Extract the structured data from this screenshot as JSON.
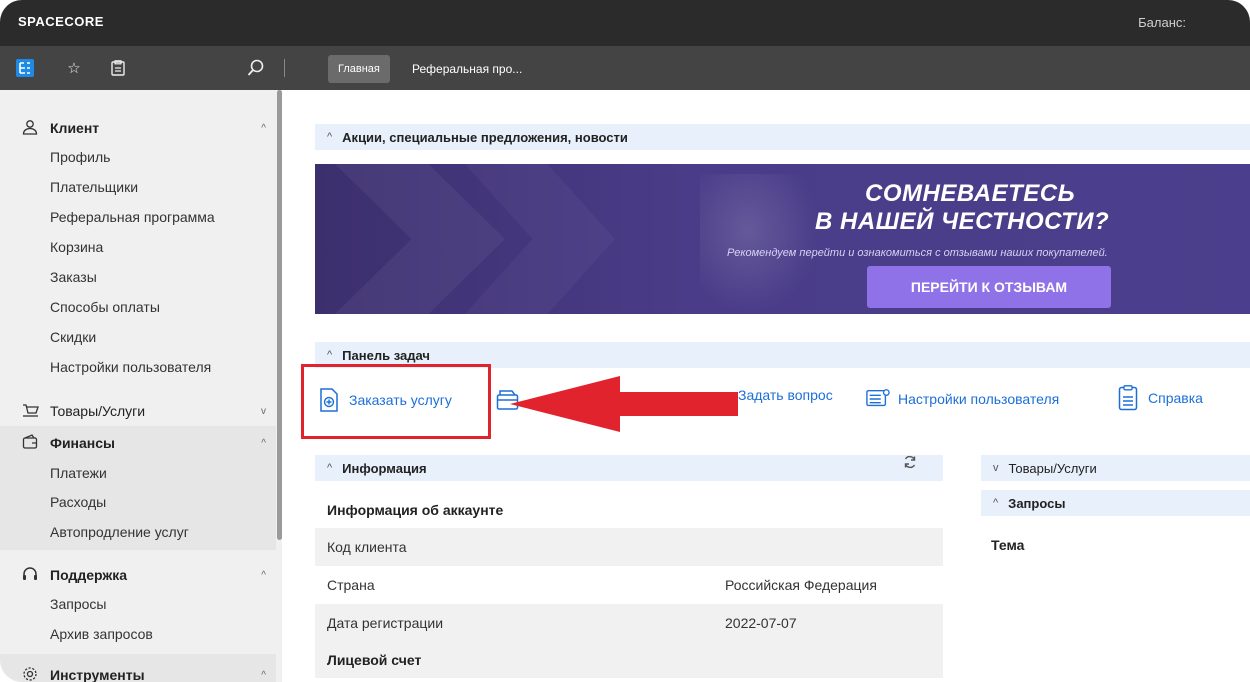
{
  "app": {
    "logo": "SPACECORE",
    "balance_label": "Баланс:"
  },
  "toolbar": {
    "icons": [
      "tree-icon",
      "star-icon",
      "clipboard-icon",
      "search-icon"
    ],
    "tabs": [
      {
        "label": "Главная",
        "active": true
      },
      {
        "label": "Реферальная про...",
        "active": false
      }
    ]
  },
  "sidebar": {
    "groups": [
      {
        "label": "Клиент",
        "icon": "client-icon",
        "expanded": true,
        "items": [
          "Профиль",
          "Плательщики",
          "Реферальная программа",
          "Корзина",
          "Заказы",
          "Способы оплаты",
          "Скидки",
          "Настройки пользователя"
        ]
      },
      {
        "label": "Товары/Услуги",
        "icon": "cart-icon",
        "expanded": false,
        "items": []
      },
      {
        "label": "Финансы",
        "icon": "wallet-icon",
        "expanded": true,
        "items": [
          "Платежи",
          "Расходы",
          "Автопродление услуг"
        ]
      },
      {
        "label": "Поддержка",
        "icon": "headset-icon",
        "expanded": true,
        "items": [
          "Запросы",
          "Архив запросов"
        ]
      },
      {
        "label": "Инструменты",
        "icon": "gear-icon",
        "expanded": true,
        "items": []
      }
    ]
  },
  "main": {
    "news_section": "Акции, специальные предложения, новости",
    "banner": {
      "title_line1": "СОМНЕВАЕТЕСЬ",
      "title_line2": "В НАШЕЙ ЧЕСТНОСТИ?",
      "subtitle": "Рекомендуем перейти и ознакомиться с отзывами наших покупателей.",
      "button": "ПЕРЕЙТИ К ОТЗЫВАМ"
    },
    "tasks_section": "Панель задач",
    "tasks": [
      {
        "label": "Заказать услугу",
        "icon": "add-document-icon"
      },
      {
        "label": "",
        "icon": "wallet-card-icon"
      },
      {
        "label": "Задать вопрос",
        "icon": "question-icon"
      },
      {
        "label": "Настройки пользователя",
        "icon": "settings-list-icon"
      },
      {
        "label": "Справка",
        "icon": "help-document-icon"
      }
    ],
    "info_section": "Информация",
    "info": {
      "account_header": "Информация об аккаунте",
      "rows": [
        {
          "key": "Код клиента",
          "value": ""
        },
        {
          "key": "Страна",
          "value": "Российская Федерация"
        },
        {
          "key": "Дата регистрации",
          "value": "2022-07-07"
        }
      ],
      "ledger_header": "Лицевой счет"
    },
    "goods_section": "Товары/Услуги",
    "requests_section": "Запросы",
    "requests_col": "Тема"
  },
  "colors": {
    "accent": "#1d6fd8",
    "highlight": "#e0232d",
    "banner_button": "#8f72e8",
    "section_bg": "#e8f0fb"
  }
}
